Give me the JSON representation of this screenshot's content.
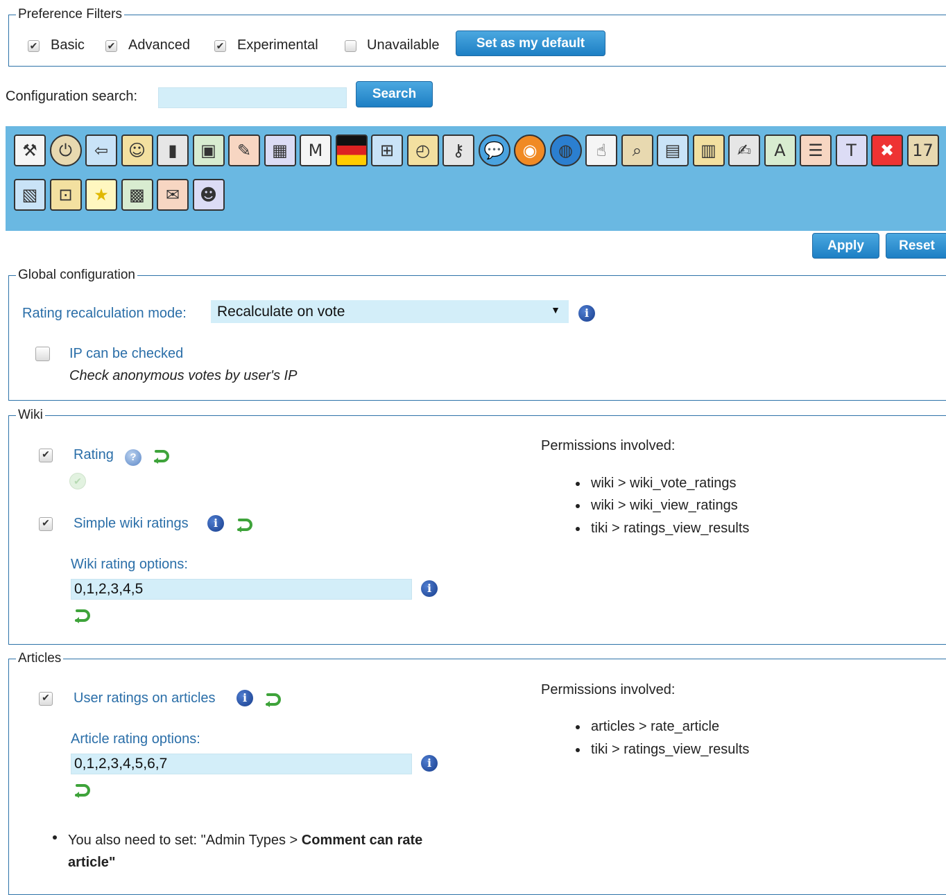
{
  "preference_filters": {
    "legend": "Preference Filters",
    "basic": {
      "label": "Basic",
      "checked": true
    },
    "advanced": {
      "label": "Advanced",
      "checked": true
    },
    "experimental": {
      "label": "Experimental",
      "checked": true
    },
    "unavailable": {
      "label": "Unavailable",
      "checked": false
    },
    "default_button": "Set as my default"
  },
  "search": {
    "label": "Configuration search:",
    "value": "",
    "button": "Search"
  },
  "toolbar": {
    "background": "#6ab8e2",
    "icons": [
      "general-settings-icon",
      "power-icon",
      "login-icon",
      "community-icon",
      "profiles-icon",
      "look-and-feel-icon",
      "text-area-icon",
      "modules-icon",
      "metatags-icon",
      "i18n-flag-icon",
      "maps-icon",
      "performance-stopwatch-icon",
      "security-key-icon",
      "comments-icon",
      "rss-icon",
      "intertiki-icon",
      "sefurl-icon",
      "search-icon",
      "wiki-icon",
      "file-galleries-icon",
      "blogs-icon",
      "fonts-icon",
      "articles-icon",
      "trackers-icon",
      "polls-icon",
      "calendar-icon",
      "webmail-icon",
      "workspaces-icon",
      "ratings-stars-icon",
      "directory-icon",
      "mail-icon",
      "users-icon"
    ]
  },
  "actions": {
    "apply": "Apply",
    "reset": "Reset"
  },
  "global_config": {
    "legend": "Global configuration",
    "mode_label": "Rating recalculation mode:",
    "mode_value": "Recalculate on vote",
    "ip_label": "IP can be checked",
    "ip_checked": false,
    "ip_description": "Check anonymous votes by user's IP"
  },
  "wiki": {
    "legend": "Wiki",
    "rating_label": "Rating",
    "rating_checked": true,
    "simple_label": "Simple wiki ratings",
    "simple_checked": true,
    "options_label": "Wiki rating options:",
    "options_value": "0,1,2,3,4,5",
    "permissions_title": "Permissions involved:",
    "permissions": [
      "wiki > wiki_vote_ratings",
      "wiki > wiki_view_ratings",
      "tiki > ratings_view_results"
    ]
  },
  "articles": {
    "legend": "Articles",
    "user_ratings_label": "User ratings on articles",
    "user_ratings_checked": true,
    "options_label": "Article rating options:",
    "options_value": "0,1,2,3,4,5,6,7",
    "permissions_title": "Permissions involved:",
    "permissions": [
      "articles > rate_article",
      "tiki > ratings_view_results"
    ],
    "note_prefix": "You also need to set: \"Admin Types > ",
    "note_bold": "Comment can rate",
    "note_bold2": "article",
    "note_suffix": "\""
  }
}
